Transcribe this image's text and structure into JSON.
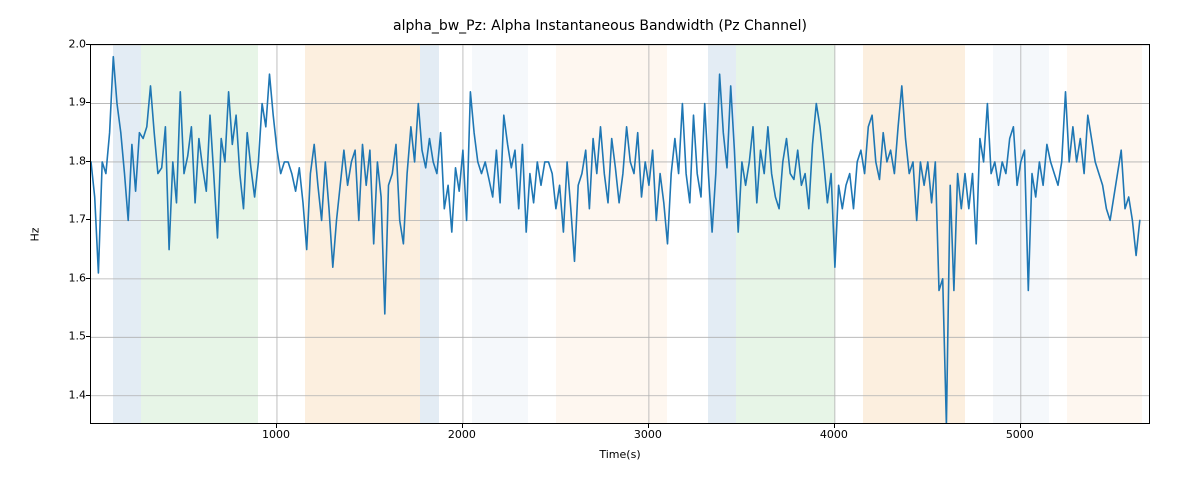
{
  "chart_data": {
    "type": "line",
    "title": "alpha_bw_Pz: Alpha Instantaneous Bandwidth (Pz Channel)",
    "xlabel": "Time(s)",
    "ylabel": "Hz",
    "xlim": [
      0,
      5700
    ],
    "ylim": [
      1.35,
      2.0
    ],
    "xticks": [
      1000,
      2000,
      3000,
      4000,
      5000
    ],
    "yticks": [
      1.4,
      1.5,
      1.6,
      1.7,
      1.8,
      1.9,
      2.0
    ],
    "bands": [
      {
        "x0": 120,
        "x1": 270,
        "color": "#a7c4dd"
      },
      {
        "x0": 270,
        "x1": 900,
        "color": "#b4dfb4"
      },
      {
        "x0": 1150,
        "x1": 1770,
        "color": "#f7ce9c"
      },
      {
        "x0": 1770,
        "x1": 1870,
        "color": "#a7c4dd"
      },
      {
        "x0": 2050,
        "x1": 2350,
        "color": "#dfe8f3"
      },
      {
        "x0": 2500,
        "x1": 3100,
        "color": "#fbe7cf"
      },
      {
        "x0": 3320,
        "x1": 3470,
        "color": "#a7c4dd"
      },
      {
        "x0": 3470,
        "x1": 4000,
        "color": "#b4dfb4"
      },
      {
        "x0": 4150,
        "x1": 4700,
        "color": "#f7ce9c"
      },
      {
        "x0": 4850,
        "x1": 5150,
        "color": "#dfe8f3"
      },
      {
        "x0": 5250,
        "x1": 5650,
        "color": "#fbe7cf"
      }
    ],
    "series": [
      {
        "name": "alpha_bw_Pz",
        "x_step": 20,
        "x_start": 0,
        "values": [
          1.8,
          1.74,
          1.61,
          1.8,
          1.78,
          1.85,
          1.98,
          1.9,
          1.85,
          1.78,
          1.7,
          1.83,
          1.75,
          1.85,
          1.84,
          1.86,
          1.93,
          1.85,
          1.78,
          1.79,
          1.86,
          1.65,
          1.8,
          1.73,
          1.92,
          1.78,
          1.81,
          1.86,
          1.73,
          1.84,
          1.79,
          1.75,
          1.88,
          1.78,
          1.67,
          1.84,
          1.8,
          1.92,
          1.83,
          1.88,
          1.78,
          1.72,
          1.85,
          1.79,
          1.74,
          1.8,
          1.9,
          1.86,
          1.95,
          1.88,
          1.82,
          1.78,
          1.8,
          1.8,
          1.78,
          1.75,
          1.79,
          1.73,
          1.65,
          1.78,
          1.83,
          1.76,
          1.7,
          1.8,
          1.72,
          1.62,
          1.7,
          1.76,
          1.82,
          1.76,
          1.8,
          1.82,
          1.7,
          1.83,
          1.76,
          1.82,
          1.66,
          1.8,
          1.74,
          1.54,
          1.76,
          1.78,
          1.83,
          1.7,
          1.66,
          1.78,
          1.86,
          1.8,
          1.9,
          1.82,
          1.79,
          1.84,
          1.8,
          1.78,
          1.85,
          1.72,
          1.76,
          1.68,
          1.79,
          1.75,
          1.82,
          1.7,
          1.92,
          1.85,
          1.8,
          1.78,
          1.8,
          1.77,
          1.74,
          1.82,
          1.73,
          1.88,
          1.83,
          1.79,
          1.82,
          1.72,
          1.83,
          1.68,
          1.78,
          1.73,
          1.8,
          1.76,
          1.8,
          1.8,
          1.78,
          1.72,
          1.76,
          1.68,
          1.8,
          1.72,
          1.63,
          1.76,
          1.78,
          1.82,
          1.72,
          1.84,
          1.78,
          1.86,
          1.78,
          1.73,
          1.84,
          1.79,
          1.73,
          1.78,
          1.86,
          1.8,
          1.78,
          1.85,
          1.74,
          1.8,
          1.76,
          1.82,
          1.7,
          1.78,
          1.73,
          1.66,
          1.78,
          1.84,
          1.78,
          1.9,
          1.78,
          1.73,
          1.88,
          1.78,
          1.74,
          1.9,
          1.78,
          1.68,
          1.78,
          1.95,
          1.85,
          1.79,
          1.93,
          1.82,
          1.68,
          1.8,
          1.76,
          1.8,
          1.86,
          1.73,
          1.82,
          1.78,
          1.86,
          1.78,
          1.74,
          1.72,
          1.8,
          1.84,
          1.78,
          1.77,
          1.82,
          1.76,
          1.78,
          1.72,
          1.83,
          1.9,
          1.86,
          1.8,
          1.73,
          1.78,
          1.62,
          1.76,
          1.72,
          1.76,
          1.78,
          1.72,
          1.8,
          1.82,
          1.78,
          1.86,
          1.88,
          1.8,
          1.77,
          1.85,
          1.8,
          1.82,
          1.78,
          1.86,
          1.93,
          1.84,
          1.78,
          1.8,
          1.7,
          1.8,
          1.76,
          1.8,
          1.73,
          1.8,
          1.58,
          1.6,
          1.35,
          1.76,
          1.58,
          1.78,
          1.72,
          1.78,
          1.72,
          1.78,
          1.66,
          1.84,
          1.8,
          1.9,
          1.78,
          1.8,
          1.76,
          1.8,
          1.78,
          1.84,
          1.86,
          1.76,
          1.8,
          1.82,
          1.58,
          1.78,
          1.74,
          1.8,
          1.76,
          1.83,
          1.8,
          1.78,
          1.76,
          1.8,
          1.92,
          1.8,
          1.86,
          1.8,
          1.84,
          1.78,
          1.88,
          1.84,
          1.8,
          1.78,
          1.76,
          1.72,
          1.7,
          1.74,
          1.78,
          1.82,
          1.72,
          1.74,
          1.7,
          1.64,
          1.7
        ]
      }
    ]
  }
}
